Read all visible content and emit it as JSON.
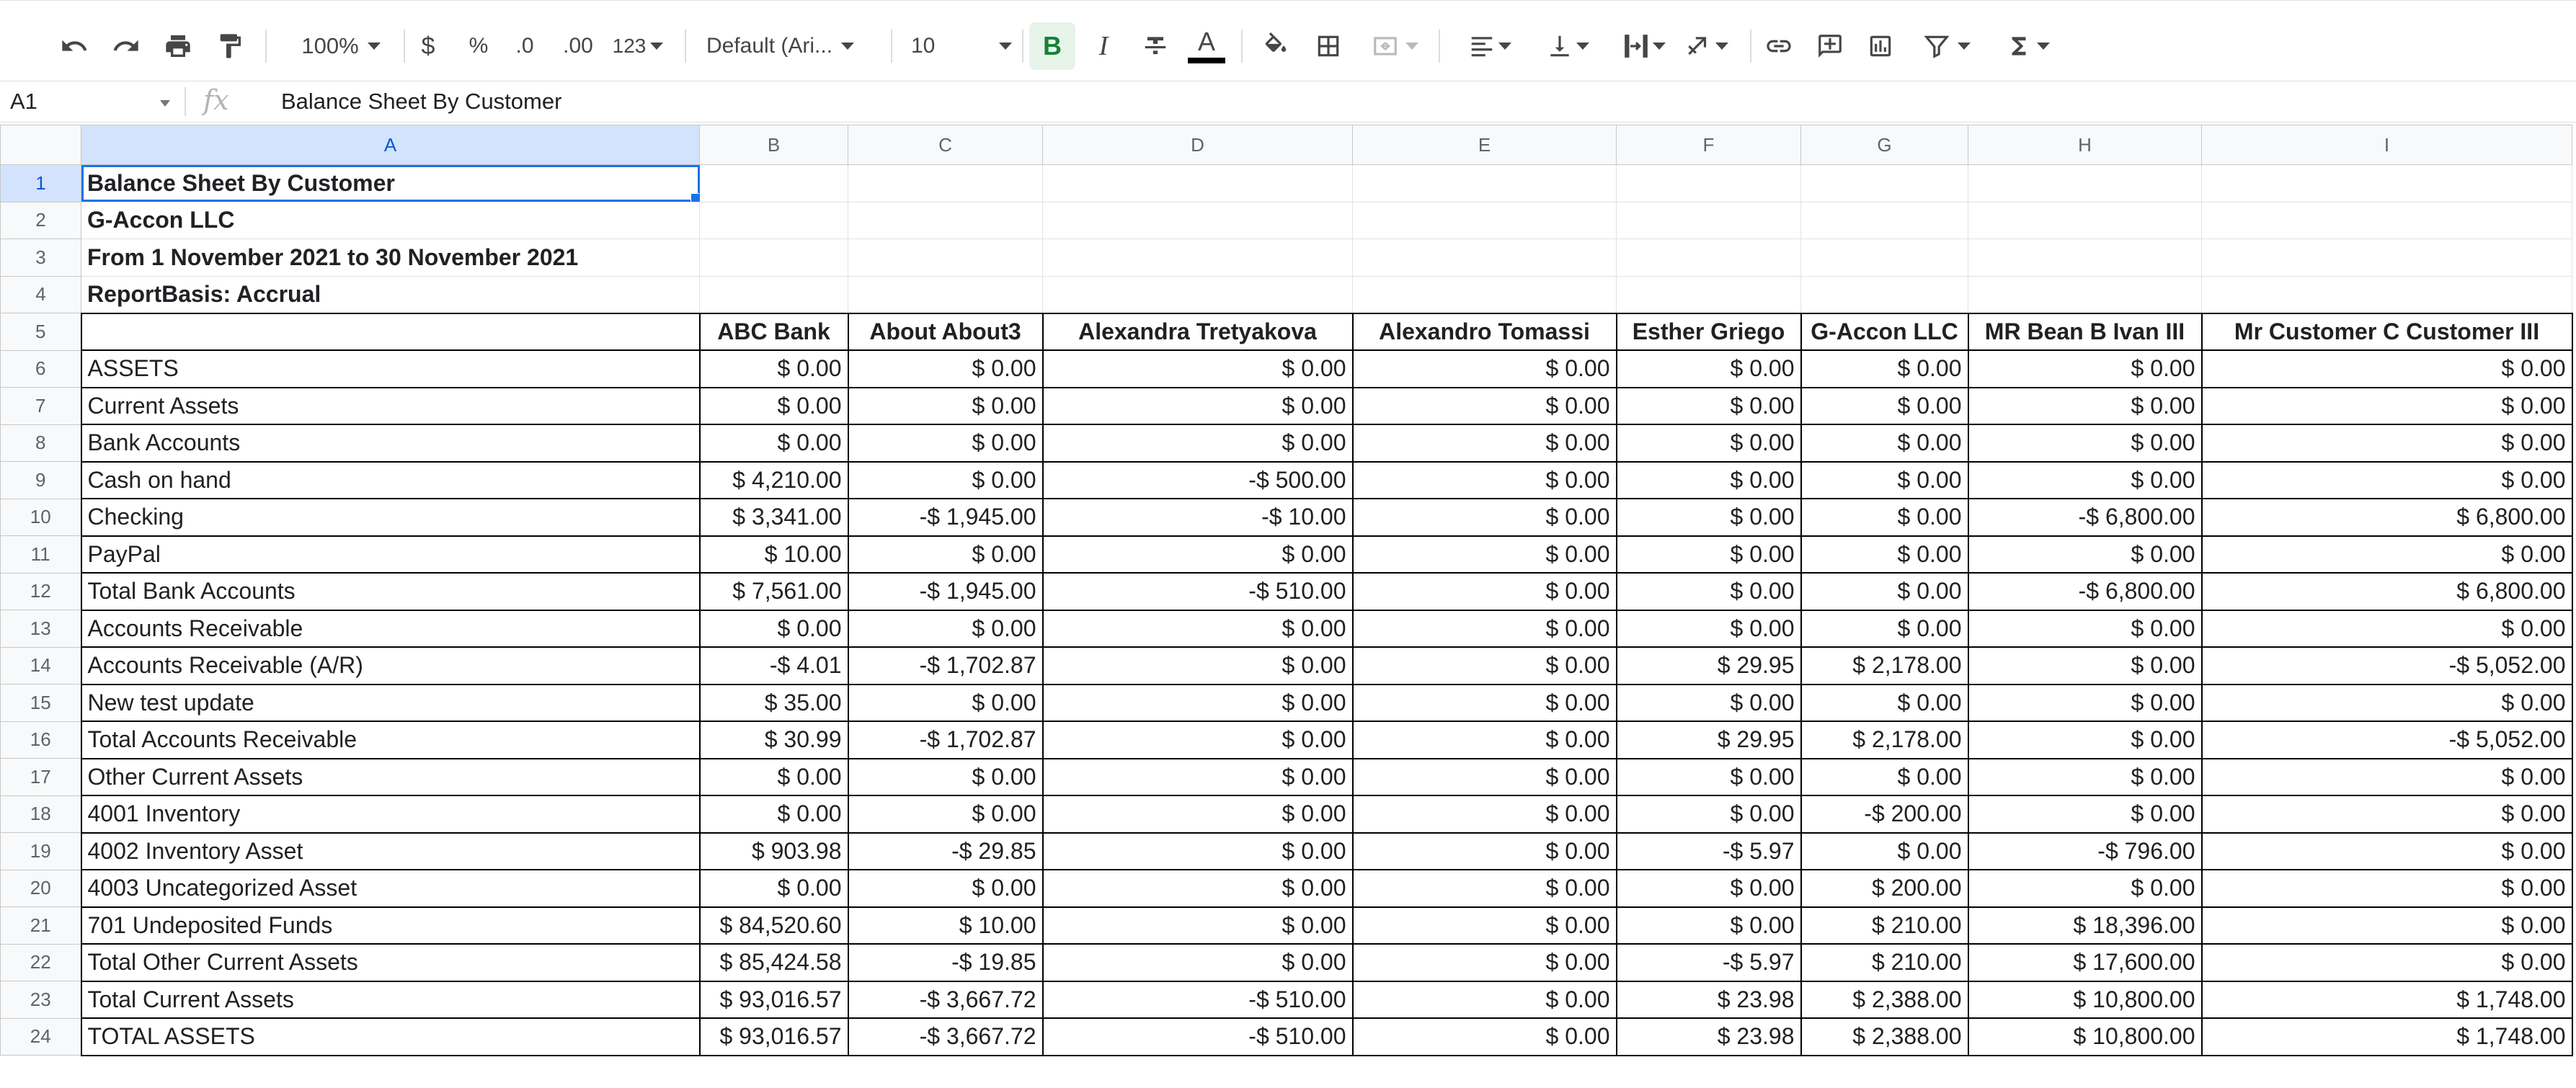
{
  "toolbar": {
    "zoom": "100%",
    "currency": "$",
    "percent": "%",
    "decrease_decimal": ".0",
    "increase_decimal": ".00",
    "more_formats": "123",
    "font": "Default (Ari...",
    "font_size": "10",
    "bold": "B",
    "italic": "I",
    "text_color_letter": "A"
  },
  "formula_bar": {
    "cell_ref": "A1",
    "fx": "fx",
    "content": "Balance Sheet By Customer"
  },
  "columns": [
    "A",
    "B",
    "C",
    "D",
    "E",
    "F",
    "G",
    "H",
    "I"
  ],
  "rows": [
    [
      "Balance Sheet By Customer",
      "",
      "",
      "",
      "",
      "",
      "",
      "",
      ""
    ],
    [
      "G-Accon LLC",
      "",
      "",
      "",
      "",
      "",
      "",
      "",
      ""
    ],
    [
      "From 1 November 2021 to 30 November 2021",
      "",
      "",
      "",
      "",
      "",
      "",
      "",
      ""
    ],
    [
      "ReportBasis: Accrual",
      "",
      "",
      "",
      "",
      "",
      "",
      "",
      ""
    ],
    [
      "",
      "ABC Bank",
      "About About3",
      "Alexandra Tretyakova",
      "Alexandro Tomassi",
      "Esther Griego",
      "G-Accon LLC",
      "MR Bean B Ivan III",
      "Mr Customer C Customer III"
    ],
    [
      "ASSETS",
      "$ 0.00",
      "$ 0.00",
      "$ 0.00",
      "$ 0.00",
      "$ 0.00",
      "$ 0.00",
      "$ 0.00",
      "$ 0.00"
    ],
    [
      "Current Assets",
      "$ 0.00",
      "$ 0.00",
      "$ 0.00",
      "$ 0.00",
      "$ 0.00",
      "$ 0.00",
      "$ 0.00",
      "$ 0.00"
    ],
    [
      "Bank Accounts",
      "$ 0.00",
      "$ 0.00",
      "$ 0.00",
      "$ 0.00",
      "$ 0.00",
      "$ 0.00",
      "$ 0.00",
      "$ 0.00"
    ],
    [
      "Cash on hand",
      "$ 4,210.00",
      "$ 0.00",
      "-$ 500.00",
      "$ 0.00",
      "$ 0.00",
      "$ 0.00",
      "$ 0.00",
      "$ 0.00"
    ],
    [
      "Checking",
      "$ 3,341.00",
      "-$ 1,945.00",
      "-$ 10.00",
      "$ 0.00",
      "$ 0.00",
      "$ 0.00",
      "-$ 6,800.00",
      "$ 6,800.00"
    ],
    [
      "PayPal",
      "$ 10.00",
      "$ 0.00",
      "$ 0.00",
      "$ 0.00",
      "$ 0.00",
      "$ 0.00",
      "$ 0.00",
      "$ 0.00"
    ],
    [
      "Total Bank Accounts",
      "$ 7,561.00",
      "-$ 1,945.00",
      "-$ 510.00",
      "$ 0.00",
      "$ 0.00",
      "$ 0.00",
      "-$ 6,800.00",
      "$ 6,800.00"
    ],
    [
      "Accounts Receivable",
      "$ 0.00",
      "$ 0.00",
      "$ 0.00",
      "$ 0.00",
      "$ 0.00",
      "$ 0.00",
      "$ 0.00",
      "$ 0.00"
    ],
    [
      "Accounts Receivable (A/R)",
      "-$ 4.01",
      "-$ 1,702.87",
      "$ 0.00",
      "$ 0.00",
      "$ 29.95",
      "$ 2,178.00",
      "$ 0.00",
      "-$ 5,052.00"
    ],
    [
      "New test update",
      "$ 35.00",
      "$ 0.00",
      "$ 0.00",
      "$ 0.00",
      "$ 0.00",
      "$ 0.00",
      "$ 0.00",
      "$ 0.00"
    ],
    [
      "Total Accounts Receivable",
      "$ 30.99",
      "-$ 1,702.87",
      "$ 0.00",
      "$ 0.00",
      "$ 29.95",
      "$ 2,178.00",
      "$ 0.00",
      "-$ 5,052.00"
    ],
    [
      "Other Current Assets",
      "$ 0.00",
      "$ 0.00",
      "$ 0.00",
      "$ 0.00",
      "$ 0.00",
      "$ 0.00",
      "$ 0.00",
      "$ 0.00"
    ],
    [
      "4001 Inventory",
      "$ 0.00",
      "$ 0.00",
      "$ 0.00",
      "$ 0.00",
      "$ 0.00",
      "-$ 200.00",
      "$ 0.00",
      "$ 0.00"
    ],
    [
      "4002 Inventory Asset",
      "$ 903.98",
      "-$ 29.85",
      "$ 0.00",
      "$ 0.00",
      "-$ 5.97",
      "$ 0.00",
      "-$ 796.00",
      "$ 0.00"
    ],
    [
      "4003 Uncategorized Asset",
      "$ 0.00",
      "$ 0.00",
      "$ 0.00",
      "$ 0.00",
      "$ 0.00",
      "$ 200.00",
      "$ 0.00",
      "$ 0.00"
    ],
    [
      "701 Undeposited Funds",
      "$ 84,520.60",
      "$ 10.00",
      "$ 0.00",
      "$ 0.00",
      "$ 0.00",
      "$ 210.00",
      "$ 18,396.00",
      "$ 0.00"
    ],
    [
      "Total Other Current Assets",
      "$ 85,424.58",
      "-$ 19.85",
      "$ 0.00",
      "$ 0.00",
      "-$ 5.97",
      "$ 210.00",
      "$ 17,600.00",
      "$ 0.00"
    ],
    [
      "Total Current Assets",
      "$ 93,016.57",
      "-$ 3,667.72",
      "-$ 510.00",
      "$ 0.00",
      "$ 23.98",
      "$ 2,388.00",
      "$ 10,800.00",
      "$ 1,748.00"
    ],
    [
      "TOTAL ASSETS",
      "$ 93,016.57",
      "-$ 3,667.72",
      "-$ 510.00",
      "$ 0.00",
      "$ 23.98",
      "$ 2,388.00",
      "$ 10,800.00",
      "$ 1,748.00"
    ]
  ]
}
